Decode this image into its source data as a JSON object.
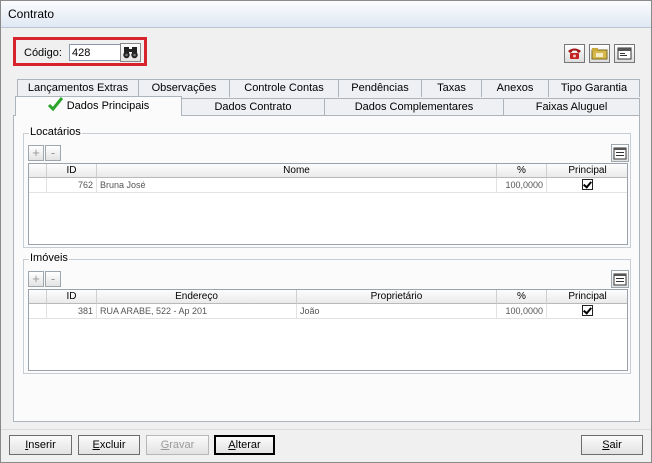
{
  "window": {
    "title": "Contrato"
  },
  "header": {
    "codigo_label": "Código:",
    "codigo_value": "428"
  },
  "tabs_row1": [
    {
      "label": "Lançamentos Extras"
    },
    {
      "label": "Observações"
    },
    {
      "label": "Controle Contas"
    },
    {
      "label": "Pendências"
    },
    {
      "label": "Taxas"
    },
    {
      "label": "Anexos"
    },
    {
      "label": "Tipo Garantia"
    }
  ],
  "tabs_row2": [
    {
      "label": "Dados Principais",
      "selected": true
    },
    {
      "label": "Dados Contrato"
    },
    {
      "label": "Dados Complementares"
    },
    {
      "label": "Faixas Aluguel"
    }
  ],
  "locatarios": {
    "title": "Locatários",
    "add": "+",
    "remove": "-",
    "columns": [
      "ID",
      "Nome",
      "%",
      "Principal"
    ],
    "rows": [
      {
        "id": "762",
        "nome": "Bruna José",
        "pct": "100,0000",
        "principal": true
      }
    ]
  },
  "imoveis": {
    "title": "Imóveis",
    "add": "+",
    "remove": "-",
    "columns": [
      "ID",
      "Endereço",
      "Proprietário",
      "%",
      "Principal"
    ],
    "rows": [
      {
        "id": "381",
        "endereco": "RUA ARABE, 522 - Ap 201",
        "proprietario": "João",
        "pct": "100,0000",
        "principal": true
      }
    ]
  },
  "footer": {
    "inserir_u": "I",
    "inserir_rest": "nserir",
    "excluir_u": "E",
    "excluir_rest": "xcluir",
    "gravar_u": "G",
    "gravar_rest": "ravar",
    "alterar_u": "A",
    "alterar_rest": "lterar",
    "sair_u": "S",
    "sair_rest": "air"
  },
  "colors": {
    "highlight": "#d7232b",
    "check": "#2aa52a"
  }
}
